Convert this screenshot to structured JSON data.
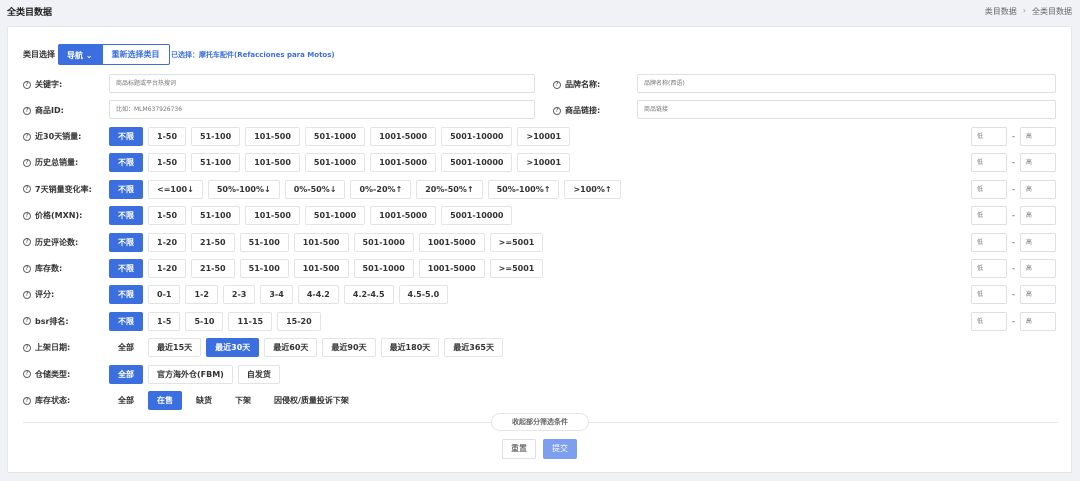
{
  "header": {
    "title": "全类目数据",
    "breadcrumb": [
      "类目数据",
      "全类目数据"
    ],
    "breadcrumb_sep": "›"
  },
  "category": {
    "label": "类目选择",
    "nav_label": "导航",
    "nav_chevron": "⌄",
    "reselect_label": "重新选择类目",
    "selected_text": "已选择：摩托车配件(Refacciones para Motos)"
  },
  "help_icon": "?",
  "fields": {
    "keyword": {
      "label": "关键字:",
      "placeholder": "商品标题或平台热搜词"
    },
    "brand": {
      "label": "品牌名称:",
      "placeholder": "品牌名称(西语)"
    },
    "product_id": {
      "label": "商品ID:",
      "placeholder": "比如：MLM637926736"
    },
    "product_link": {
      "label": "商品链接:",
      "placeholder": "商品链接"
    }
  },
  "range": {
    "low": "低",
    "high": "高",
    "dash": "-"
  },
  "filters": [
    {
      "key": "sales30",
      "label": "近30天销量:",
      "options": [
        "不限",
        "1-50",
        "51-100",
        "101-500",
        "501-1000",
        "1001-5000",
        "5001-10000",
        ">10001"
      ],
      "active": 0,
      "range": true
    },
    {
      "key": "total_sales",
      "label": "历史总销量:",
      "options": [
        "不限",
        "1-50",
        "51-100",
        "101-500",
        "501-1000",
        "1001-5000",
        "5001-10000",
        ">10001"
      ],
      "active": 0,
      "range": true
    },
    {
      "key": "sales_change",
      "label": "7天销量变化率:",
      "options": [
        "不限",
        "<=100↓",
        "50%-100%↓",
        "0%-50%↓",
        "0%-20%↑",
        "20%-50%↑",
        "50%-100%↑",
        ">100%↑"
      ],
      "active": 0,
      "range": true
    },
    {
      "key": "price",
      "label": "价格(MXN):",
      "options": [
        "不限",
        "1-50",
        "51-100",
        "101-500",
        "501-1000",
        "1001-5000",
        "5001-10000"
      ],
      "active": 0,
      "range": true
    },
    {
      "key": "reviews",
      "label": "历史评论数:",
      "options": [
        "不限",
        "1-20",
        "21-50",
        "51-100",
        "101-500",
        "501-1000",
        "1001-5000",
        ">=5001"
      ],
      "active": 0,
      "range": true
    },
    {
      "key": "stock",
      "label": "库存数:",
      "options": [
        "不限",
        "1-20",
        "21-50",
        "51-100",
        "101-500",
        "501-1000",
        "1001-5000",
        ">=5001"
      ],
      "active": 0,
      "range": true
    },
    {
      "key": "rating",
      "label": "评分:",
      "options": [
        "不限",
        "0-1",
        "1-2",
        "2-3",
        "3-4",
        "4-4.2",
        "4.2-4.5",
        "4.5-5.0"
      ],
      "active": 0,
      "range": true
    },
    {
      "key": "bsr",
      "label": "bsr排名:",
      "options": [
        "不限",
        "1-5",
        "5-10",
        "11-15",
        "15-20"
      ],
      "active": 0,
      "range": true
    },
    {
      "key": "listed",
      "label": "上架日期:",
      "options": [
        "全部",
        "最近15天",
        "最近30天",
        "最近60天",
        "最近90天",
        "最近180天",
        "最近365天"
      ],
      "active": 2,
      "range": false
    },
    {
      "key": "warehouse",
      "label": "仓储类型:",
      "options": [
        "全部",
        "官方海外仓(FBM)",
        "自发货"
      ],
      "active": 0,
      "range": false
    },
    {
      "key": "stock_status",
      "label": "库存状态:",
      "options": [
        "全部",
        "在售",
        "缺货",
        "下架",
        "因侵权/质量投诉下架"
      ],
      "active": 1,
      "range": false,
      "plain": true
    }
  ],
  "actions": {
    "collapse_label": "收起部分筛选条件",
    "reset_label": "重置",
    "submit_label": "提交"
  }
}
